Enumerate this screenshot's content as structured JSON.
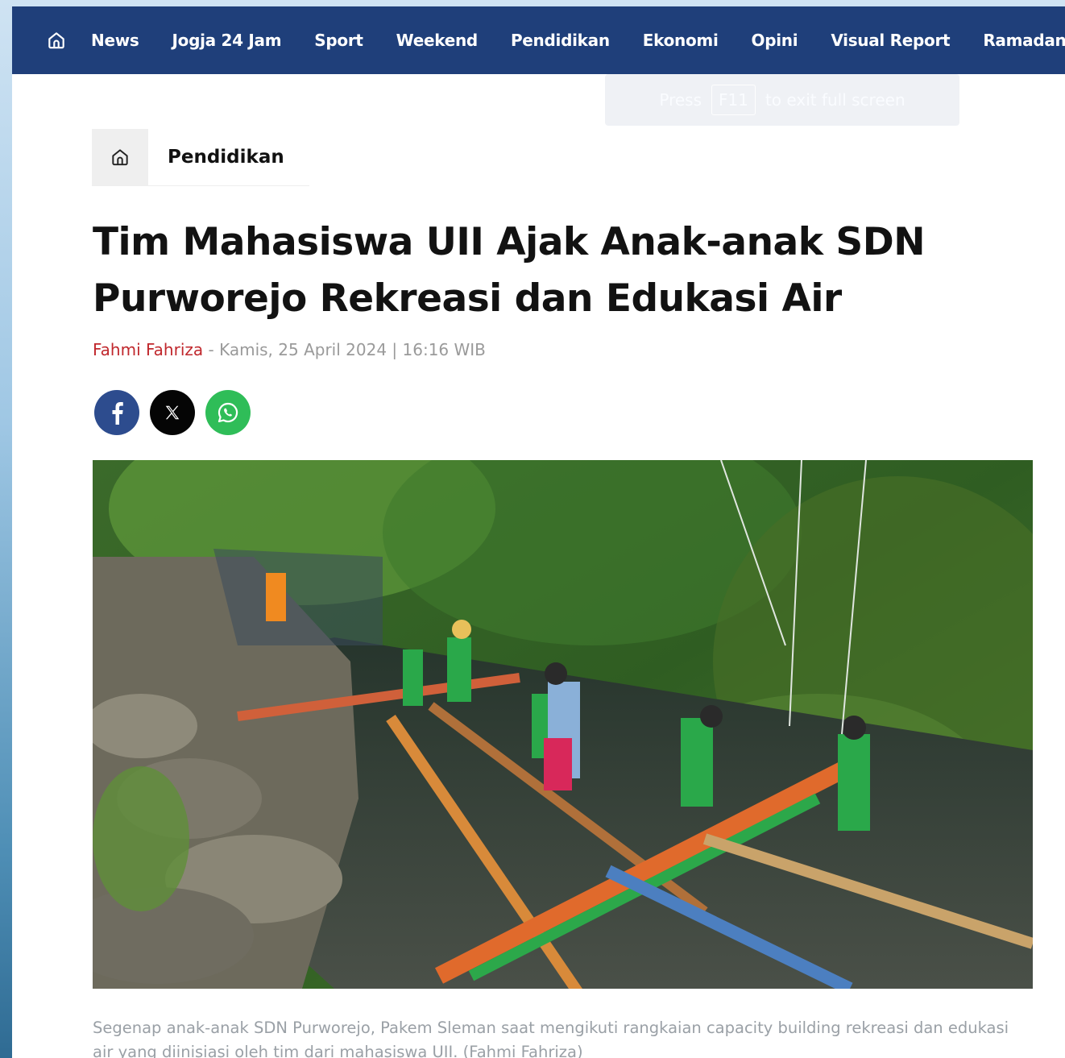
{
  "nav": {
    "items": [
      "News",
      "Jogja 24 Jam",
      "Sport",
      "Weekend",
      "Pendidikan",
      "Ekonomi",
      "Opini",
      "Visual Report",
      "Ramadan"
    ]
  },
  "fullscreen_notice": {
    "press": "Press",
    "key": "F11",
    "rest": "to exit full screen"
  },
  "breadcrumb": {
    "label": "Pendidikan"
  },
  "article": {
    "title": "Tim Mahasiswa UII Ajak Anak-anak SDN Purworejo Rekreasi dan Edukasi Air",
    "author": "Fahmi Fahriza",
    "separator": " - ",
    "date": "Kamis, 25 April 2024 | 16:16 WIB",
    "caption": "Segenap anak-anak SDN Purworejo, Pakem Sleman saat mengikuti rangkaian capacity building rekreasi dan edukasi air yang diinisiasi oleh tim dari mahasiswa UII. (Fahmi Fahriza)"
  },
  "share": {
    "facebook_icon": "facebook-icon",
    "x_icon": "x-icon",
    "whatsapp_icon": "whatsapp-icon",
    "colors": {
      "facebook": "#2d4c8e",
      "x": "#050505",
      "whatsapp": "#2fbd58"
    }
  },
  "theme": {
    "nav_bg": "#1f3f7a",
    "author_color": "#c0282d"
  }
}
